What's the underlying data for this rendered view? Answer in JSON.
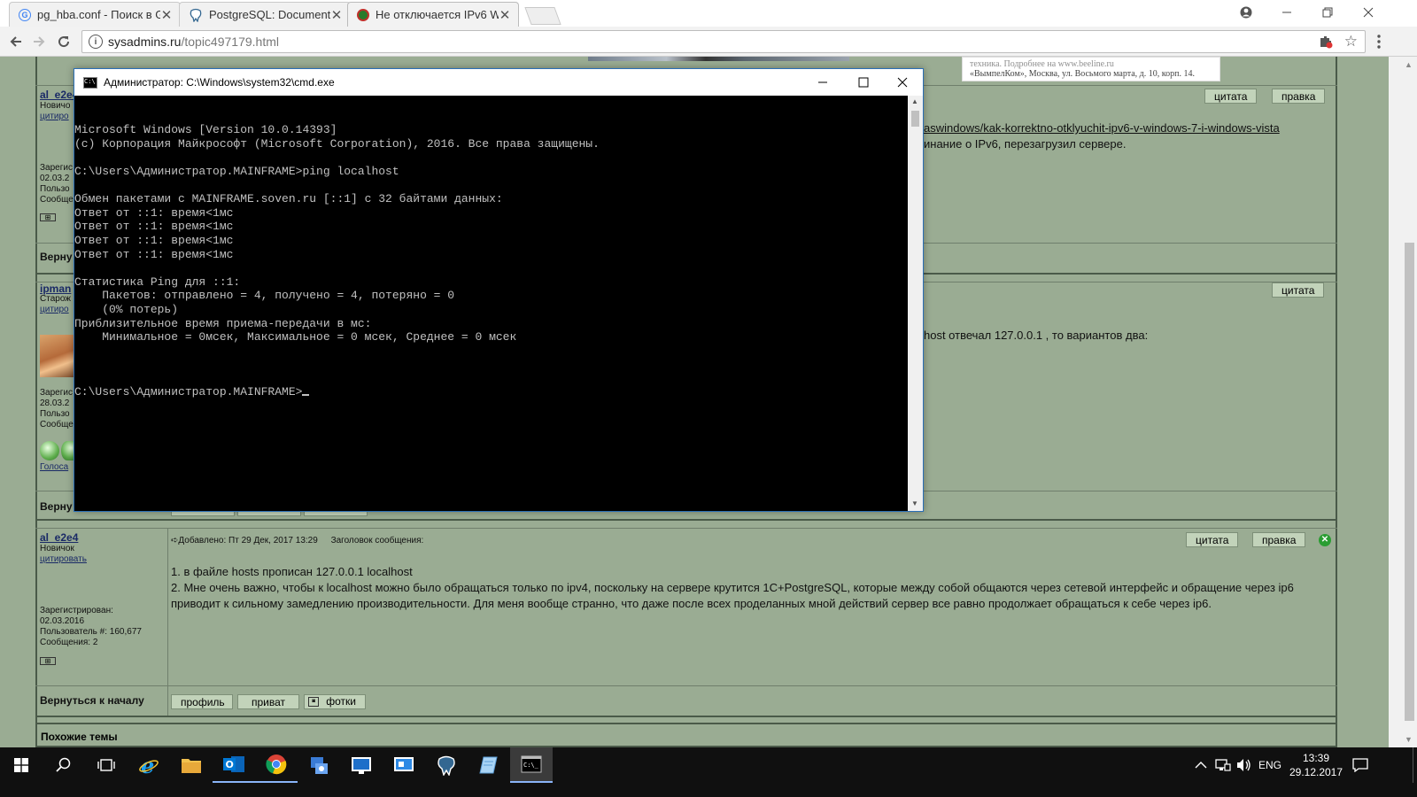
{
  "browser": {
    "tabs": [
      {
        "title": "pg_hba.conf - Поиск в G",
        "icon": "google-icon",
        "active": false
      },
      {
        "title": "PostgreSQL: Documentat",
        "icon": "postgresql-elephant-icon",
        "active": false
      },
      {
        "title": "Не отключается IPv6 Wi",
        "icon": "sysadmins-icon",
        "active": true
      }
    ],
    "close_glyph": "✕",
    "url_host": "sysadmins.ru",
    "url_path": "/topic497179.html"
  },
  "forum": {
    "ad_text": [
      "техника. Подробнее на www.beeline.ru",
      "«ВымпелКом», Москва, ул. Восьмого марта, д. 10, корп. 14."
    ],
    "post1": {
      "author": "al_e2e4",
      "rank": "Новичо",
      "quote_link": "цитиро",
      "reg_label": "Зарегис",
      "reg_date": "02.03.2",
      "user_label": "Пользо",
      "msgs_label": "Сообще",
      "btn_quote": "цитата",
      "btn_edit": "правка",
      "text_link": "aswindows/kak-korrektno-otklyuchit-ipv6-v-windows-7-i-windows-vista",
      "text_line": "инание о IPv6, перезагрузил сервере.",
      "back_top": "Верну"
    },
    "post2": {
      "author": "ipman",
      "rank": "Старож",
      "quote_link": "цитиро",
      "reg_label": "Зарегис",
      "reg_date": "28.03.2",
      "user_label": "Пользо",
      "msgs_label": "Сообще",
      "votes_link": "Голоса",
      "btn_quote": "цитата",
      "text_line": "host отвечал 127.0.0.1 , то вариантов два:",
      "back_top": "Верну"
    },
    "post3": {
      "author": "al_e2e4",
      "rank": "Новичок",
      "quote_link": "цитировать",
      "posted": "Добавлено: Пт 29 Дек, 2017 13:29",
      "subject": "Заголовок сообщения:",
      "btn_quote": "цитата",
      "btn_edit": "правка",
      "text": [
        "1. в файле hosts прописан 127.0.0.1 localhost",
        "2. Мне очень важно, чтобы к localhost можно было обращаться только по ipv4, поскольку на сервере крутится 1С+PostgreSQL, которые между собой общаются через сетевой интерфейс и обращение через ip6",
        "приводит к сильному замедлению производительности. Для меня вообще странно, что даже после всех проделанных мной действий сервер все равно продолжает обращаться к себе через ip6."
      ],
      "reg_label": "Зарегистрирован:",
      "reg_date": "02.03.2016",
      "user_no": "Пользователь #: 160,677",
      "msgs": "Сообщения: 2",
      "back_top": "Вернуться к началу",
      "btn_profile": "профиль",
      "btn_pm": "приват",
      "btn_photos": "фотки"
    },
    "similar_topics": "Похожие темы"
  },
  "cmd": {
    "title": "Администратор: C:\\Windows\\system32\\cmd.exe",
    "lines": [
      "Microsoft Windows [Version 10.0.14393]",
      "(c) Корпорация Майкрософт (Microsoft Corporation), 2016. Все права защищены.",
      "",
      "C:\\Users\\Администратор.MAINFRAME>ping localhost",
      "",
      "Обмен пакетами с MAINFRAME.soven.ru [::1] с 32 байтами данных:",
      "Ответ от ::1: время<1мс",
      "Ответ от ::1: время<1мс",
      "Ответ от ::1: время<1мс",
      "Ответ от ::1: время<1мс",
      "",
      "Статистика Ping для ::1:",
      "    Пакетов: отправлено = 4, получено = 4, потеряно = 0",
      "    (0% потерь)",
      "Приблизительное время приема-передачи в мс:",
      "    Минимальное = 0мсек, Максимальное = 0 мсек, Среднее = 0 мсек",
      ""
    ],
    "prompt": "C:\\Users\\Администратор.MAINFRAME>"
  },
  "taskbar": {
    "lang": "ENG",
    "time": "13:39",
    "date": "29.12.2017"
  }
}
